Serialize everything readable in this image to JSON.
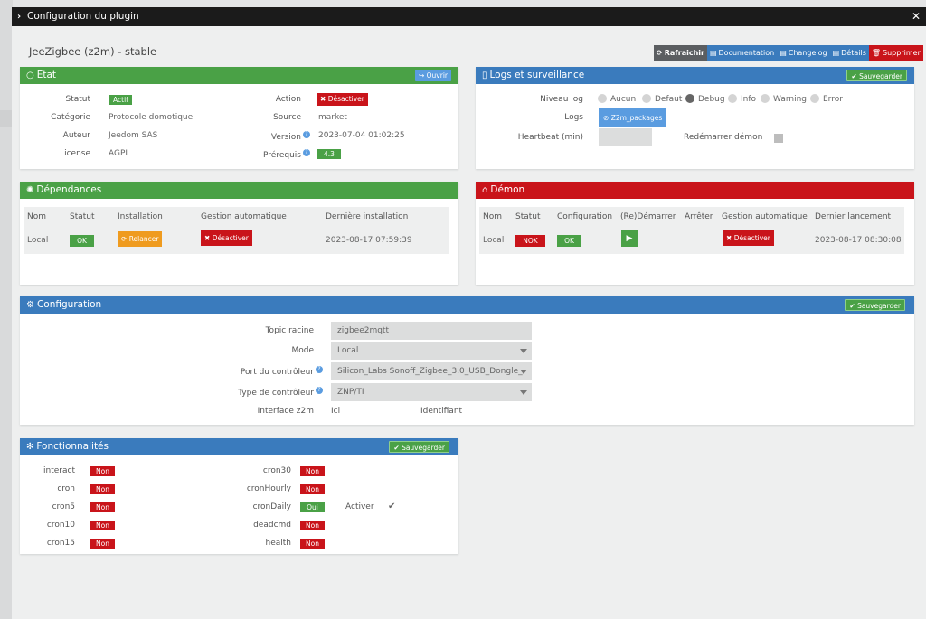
{
  "modal": {
    "title": "Configuration du plugin"
  },
  "plugin": {
    "name": "JeeZigbee (z2m) - stable"
  },
  "toolbar": {
    "refresh": "Rafraichir",
    "documentation": "Documentation",
    "changelog": "Changelog",
    "details": "Détails",
    "delete": "Supprimer"
  },
  "etat": {
    "title": "Etat",
    "open_button": "Ouvrir",
    "statut_label": "Statut",
    "statut_value": "Actif",
    "categorie_label": "Catégorie",
    "categorie_value": "Protocole domotique",
    "auteur_label": "Auteur",
    "auteur_value": "Jeedom SAS",
    "license_label": "License",
    "license_value": "AGPL",
    "action_label": "Action",
    "action_button": "Désactiver",
    "source_label": "Source",
    "source_value": "market",
    "version_label": "Version",
    "version_value": "2023-07-04 01:02:25",
    "prerequis_label": "Prérequis",
    "prerequis_value": "4.3"
  },
  "logs": {
    "title": "Logs et surveillance",
    "save_button": "Sauvegarder",
    "niveau_label": "Niveau log",
    "levels": [
      "Aucun",
      "Defaut",
      "Debug",
      "Info",
      "Warning",
      "Error"
    ],
    "selected_level": "Debug",
    "logs_label": "Logs",
    "logs_button": "Z2m_packages",
    "heartbeat_label": "Heartbeat (min)",
    "heartbeat_value": "",
    "restart_label": "Redémarrer démon"
  },
  "dependances": {
    "title": "Dépendances",
    "headers": [
      "Nom",
      "Statut",
      "Installation",
      "Gestion automatique",
      "Dernière installation"
    ],
    "row": {
      "nom": "Local",
      "statut": "OK",
      "installation": "Relancer",
      "gestion": "Désactiver",
      "derniere": "2023-08-17 07:59:39"
    }
  },
  "demon": {
    "title": "Démon",
    "headers": [
      "Nom",
      "Statut",
      "Configuration",
      "(Re)Démarrer",
      "Arrêter",
      "Gestion automatique",
      "Dernier lancement"
    ],
    "row": {
      "nom": "Local",
      "statut": "NOK",
      "configuration": "OK",
      "gestion": "Désactiver",
      "dernier": "2023-08-17 08:30:08"
    }
  },
  "configuration": {
    "title": "Configuration",
    "save_button": "Sauvegarder",
    "topic_label": "Topic racine",
    "topic_value": "zigbee2mqtt",
    "mode_label": "Mode",
    "mode_value": "Local",
    "port_label": "Port du contrôleur",
    "port_value": "Silicon_Labs Sonoff_Zigbee_3.0_USB_Dongle_",
    "type_label": "Type de contrôleur",
    "type_value": "ZNP/TI",
    "interface_label": "Interface z2m",
    "interface_value": "Ici",
    "interface_identifiant": "Identifiant"
  },
  "fonctionnalites": {
    "title": "Fonctionnalités",
    "save_button": "Sauvegarder",
    "left": [
      {
        "name": "interact",
        "value": "Non"
      },
      {
        "name": "cron",
        "value": "Non"
      },
      {
        "name": "cron5",
        "value": "Non"
      },
      {
        "name": "cron10",
        "value": "Non"
      },
      {
        "name": "cron15",
        "value": "Non"
      }
    ],
    "right": [
      {
        "name": "cron30",
        "value": "Non"
      },
      {
        "name": "cronHourly",
        "value": "Non"
      },
      {
        "name": "cronDaily",
        "value": "Oui"
      },
      {
        "name": "deadcmd",
        "value": "Non"
      },
      {
        "name": "health",
        "value": "Non"
      }
    ],
    "activer_label": "Activer"
  }
}
